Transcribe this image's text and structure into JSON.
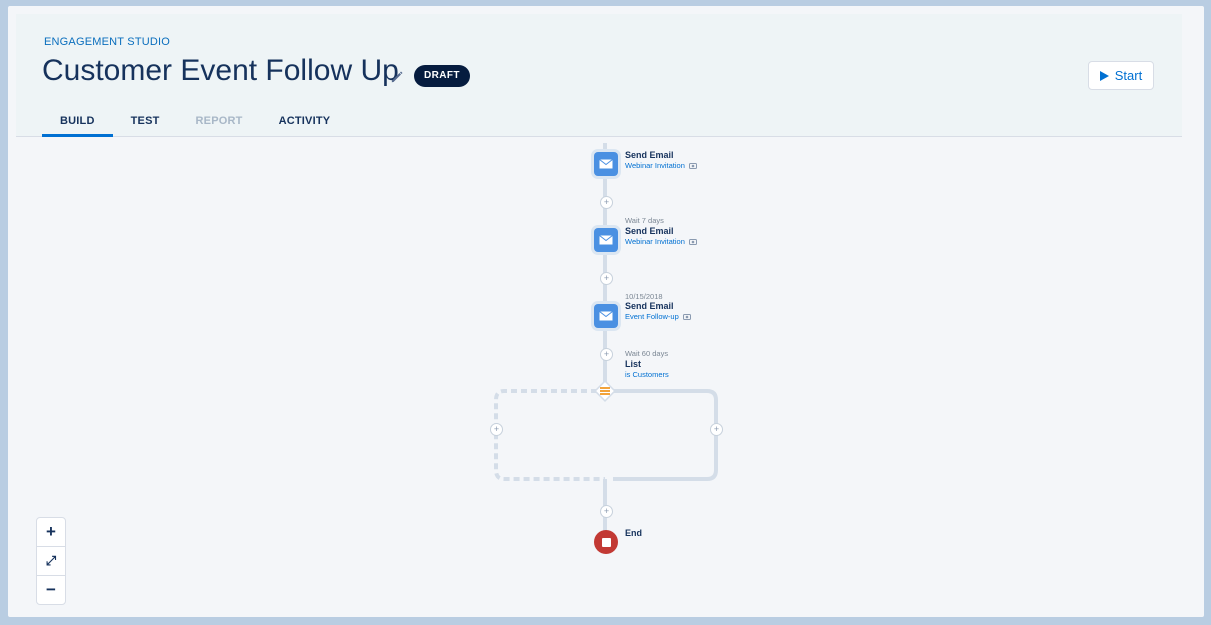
{
  "header": {
    "app_label": "ENGAGEMENT STUDIO",
    "title": "Customer Event Follow Up",
    "status_badge": "DRAFT",
    "start_label": "Start"
  },
  "tabs": [
    {
      "label": "BUILD",
      "state": "active"
    },
    {
      "label": "TEST",
      "state": "normal"
    },
    {
      "label": "REPORT",
      "state": "disabled"
    },
    {
      "label": "ACTIVITY",
      "state": "normal"
    }
  ],
  "flow": {
    "steps": [
      {
        "meta": "",
        "title": "Send Email",
        "subtitle": "Webinar Invitation",
        "icon": "email-icon"
      },
      {
        "meta": "Wait 7 days",
        "title": "Send Email",
        "subtitle": "Webinar Invitation",
        "icon": "email-icon"
      },
      {
        "meta": "10/15/2018",
        "title": "Send Email",
        "subtitle": "Event Follow-up",
        "icon": "email-icon"
      }
    ],
    "rule": {
      "meta": "Wait 60 days",
      "title": "List",
      "subtitle": "is Customers",
      "icon": "list-rule-icon"
    },
    "end": {
      "title": "End",
      "icon": "stop-icon"
    }
  },
  "zoom_controls": {
    "zoom_in": "+",
    "fit": "⤢",
    "zoom_out": "−"
  },
  "colors": {
    "accent": "#0070d2",
    "step": "#4a90e2",
    "end": "#c23934",
    "rule": "#f2a33b",
    "badge": "#061c3f"
  }
}
